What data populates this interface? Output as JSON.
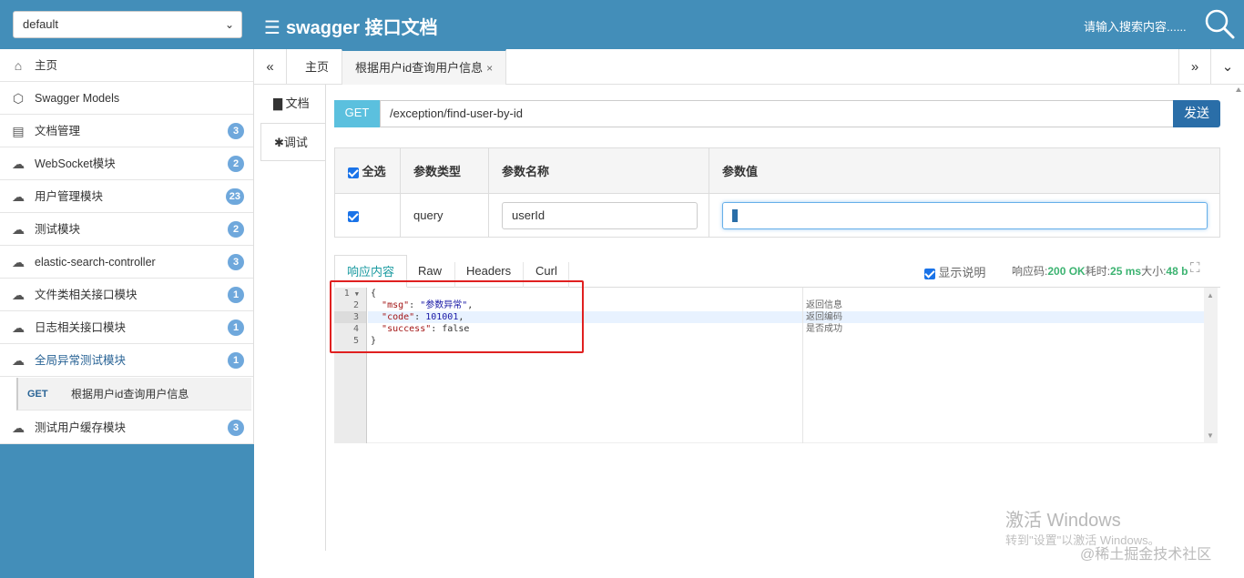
{
  "topbar": {
    "group_select": "default",
    "brand_title": "swagger 接口文档",
    "search_placeholder": "请输入搜索内容......"
  },
  "sidebar": {
    "items": [
      {
        "label": "主页",
        "badge": ""
      },
      {
        "label": "Swagger Models",
        "badge": ""
      },
      {
        "label": "文档管理",
        "badge": "3"
      },
      {
        "label": "WebSocket模块",
        "badge": "2"
      },
      {
        "label": "用户管理模块",
        "badge": "23"
      },
      {
        "label": "测试模块",
        "badge": "2"
      },
      {
        "label": "elastic-search-controller",
        "badge": "3"
      },
      {
        "label": "文件类相关接口模块",
        "badge": "1"
      },
      {
        "label": "日志相关接口模块",
        "badge": "1"
      },
      {
        "label": "全局异常测试模块",
        "badge": "1"
      }
    ],
    "sub_item": {
      "method": "GET",
      "label": "根据用户id查询用户信息"
    },
    "last_item": {
      "label": "测试用户缓存模块",
      "badge": "3"
    }
  },
  "tabs": {
    "home": "主页",
    "active": "根据用户id查询用户信息",
    "close": "×"
  },
  "vtabs": {
    "doc": "文档",
    "debug": "调试"
  },
  "request": {
    "method": "GET",
    "url": "/exception/find-user-by-id",
    "send": "发送"
  },
  "params": {
    "headers": {
      "select_all": "全选",
      "type": "参数类型",
      "name": "参数名称",
      "value": "参数值"
    },
    "rows": [
      {
        "type": "query",
        "name": "userId",
        "value": ""
      }
    ]
  },
  "response": {
    "tabs": [
      "响应内容",
      "Raw",
      "Headers",
      "Curl"
    ],
    "show_desc": "显示说明",
    "code_label": "响应码:",
    "code_value": "200 OK",
    "time_label": "耗时:",
    "time_value": "25 ms",
    "size_label": "大小:",
    "size_value": "48 b",
    "lines": [
      "1",
      "2",
      "3",
      "4",
      "5"
    ],
    "json": {
      "open": "{",
      "msg_key": "\"msg\"",
      "msg_val": "\"参数异常\"",
      "code_key": "\"code\"",
      "code_val": "101001",
      "success_key": "\"success\"",
      "success_val": "false",
      "close": "}"
    },
    "descriptions": [
      "返回信息",
      "返回编码",
      "是否成功"
    ]
  },
  "watermark": {
    "line1": "激活 Windows",
    "line2": "转到\"设置\"以激活 Windows。",
    "juejin": "@稀土掘金技术社区"
  }
}
